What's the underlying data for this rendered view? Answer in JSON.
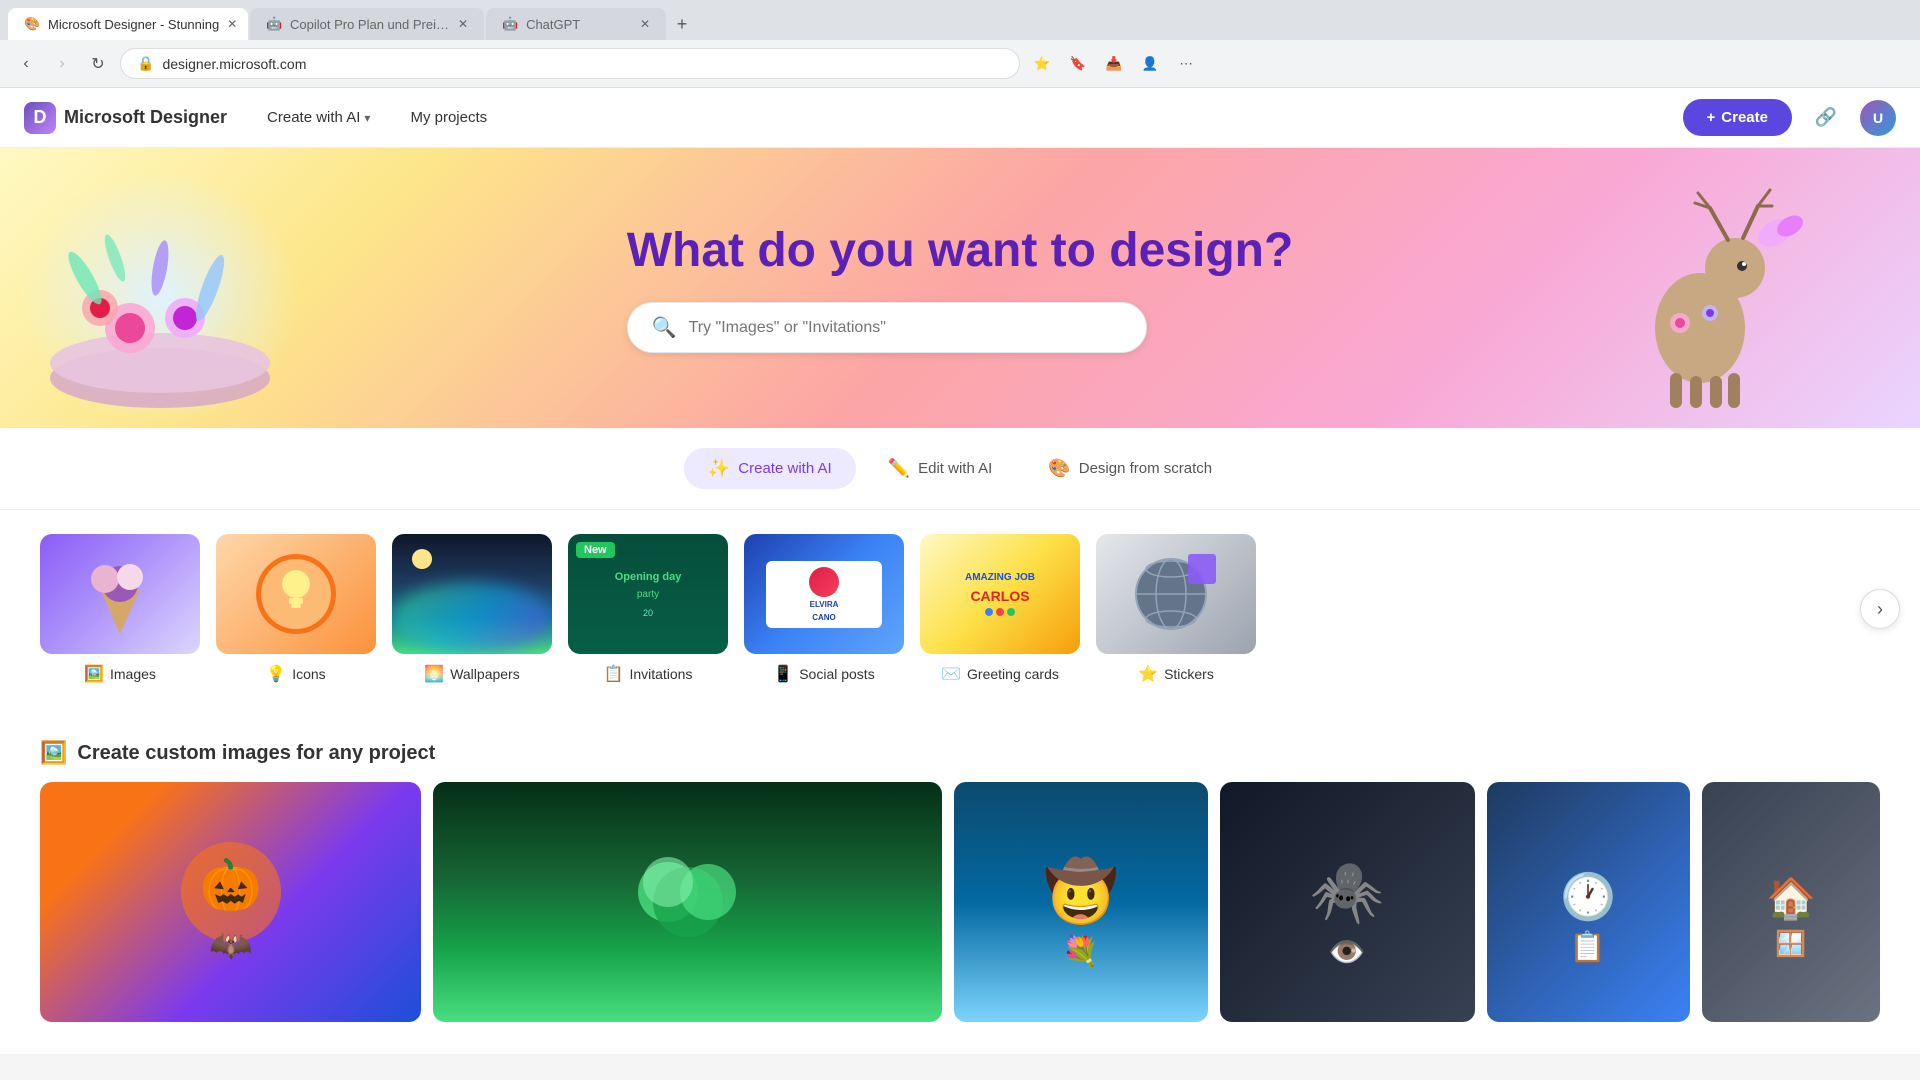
{
  "browser": {
    "tabs": [
      {
        "id": "tab1",
        "label": "Microsoft Designer - Stunning",
        "favicon": "🎨",
        "active": true
      },
      {
        "id": "tab2",
        "label": "Copilot Pro Plan und Preise – F...",
        "favicon": "🤖",
        "active": false
      },
      {
        "id": "tab3",
        "label": "ChatGPT",
        "favicon": "🤖",
        "active": false
      }
    ],
    "address": "designer.microsoft.com",
    "toolbar_icons": [
      "⭐",
      "🔖",
      "📥",
      "👤"
    ]
  },
  "header": {
    "logo_text": "Microsoft Designer",
    "nav": [
      {
        "id": "create-with-ai",
        "label": "Create with AI",
        "has_dropdown": true
      },
      {
        "id": "my-projects",
        "label": "My projects",
        "has_dropdown": false
      }
    ],
    "create_button_label": "+ Create"
  },
  "hero": {
    "title": "What do you want to design?",
    "search_placeholder": "Try \"Images\" or \"Invitations\""
  },
  "filter_tabs": [
    {
      "id": "create-with-ai",
      "label": "Create with AI",
      "icon": "✨",
      "active": true
    },
    {
      "id": "edit-with-ai",
      "label": "Edit with AI",
      "icon": "✏️",
      "active": false
    },
    {
      "id": "design-from-scratch",
      "label": "Design from scratch",
      "icon": "🎨",
      "active": false
    }
  ],
  "categories": [
    {
      "id": "images",
      "label": "Images",
      "icon": "🖼️",
      "has_new": false
    },
    {
      "id": "icons",
      "label": "Icons",
      "icon": "💡",
      "has_new": false
    },
    {
      "id": "wallpapers",
      "label": "Wallpapers",
      "icon": "🌅",
      "has_new": false
    },
    {
      "id": "invitations",
      "label": "Invitations",
      "icon": "📋",
      "has_new": true
    },
    {
      "id": "social-posts",
      "label": "Social posts",
      "icon": "📱",
      "has_new": false
    },
    {
      "id": "greeting-cards",
      "label": "Greeting cards",
      "icon": "✉️",
      "has_new": false
    },
    {
      "id": "stickers",
      "label": "Stickers",
      "icon": "⭐",
      "has_new": false
    }
  ],
  "custom_images_section": {
    "title": "Create custom images for any project",
    "icon": "🖼️"
  }
}
